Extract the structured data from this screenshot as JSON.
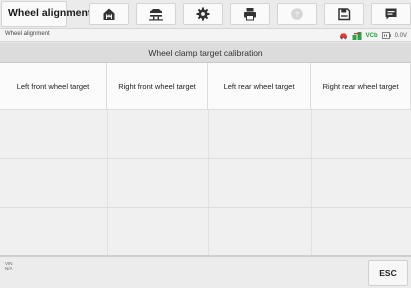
{
  "app": {
    "title": "Wheel alignment"
  },
  "toolbar": {
    "buttons": [
      {
        "icon": "home-icon"
      },
      {
        "icon": "vehicle-lift-icon"
      },
      {
        "icon": "gear-icon"
      },
      {
        "icon": "printer-icon"
      },
      {
        "icon": "help-icon"
      },
      {
        "icon": "save-icon"
      },
      {
        "icon": "message-icon"
      }
    ]
  },
  "breadcrumb": "Wheel alignment",
  "status": {
    "vcb_label": "VCb",
    "voltage": "0.0V"
  },
  "section": {
    "title": "Wheel clamp target calibration"
  },
  "table": {
    "headers": [
      "Left front wheel target",
      "Right front wheel target",
      "Left rear wheel target",
      "Right rear wheel target"
    ],
    "empty_rows": 3
  },
  "footer": {
    "vin_label": "VIN",
    "info_label": "N/A",
    "esc_label": "ESC"
  }
}
